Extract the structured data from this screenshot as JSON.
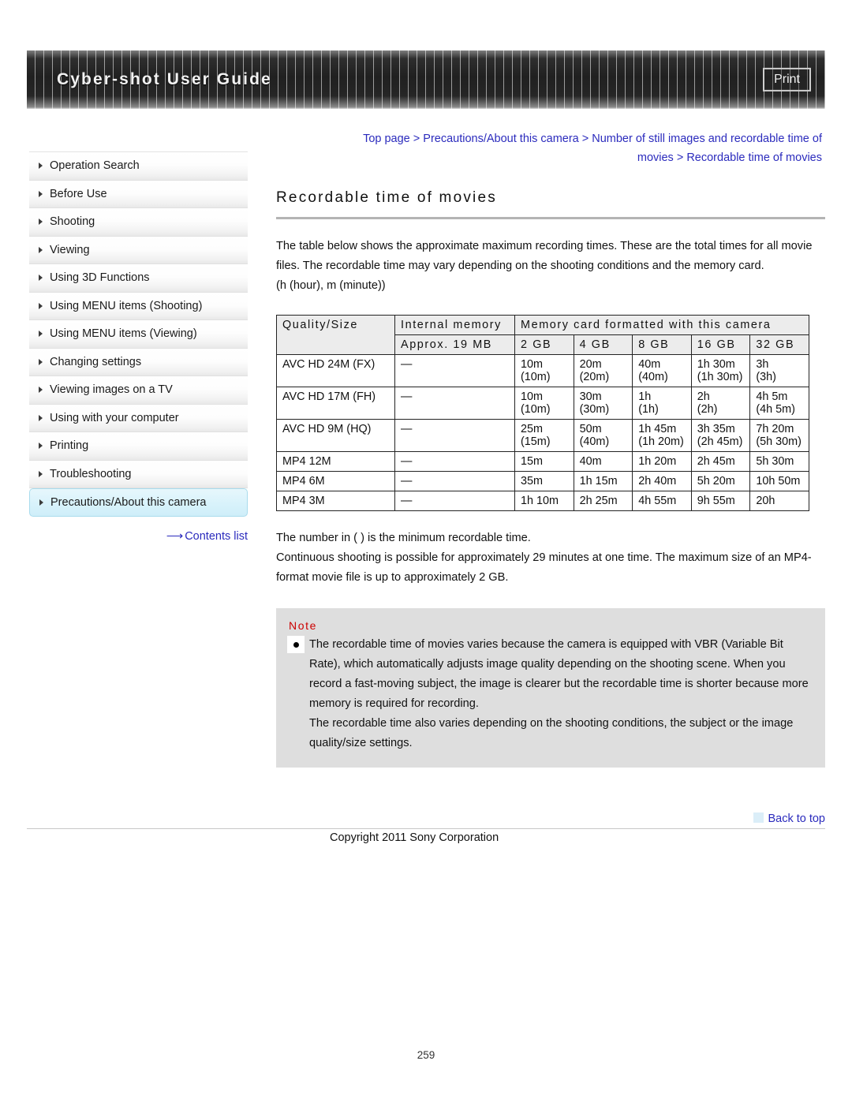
{
  "header": {
    "title": "Cyber-shot User Guide",
    "print_label": "Print"
  },
  "breadcrumb": {
    "line1": "Top page > Precautions/About this camera > Number of still images and recordable time of",
    "line2": "movies > Recordable time of movies"
  },
  "sidebar": {
    "items": [
      {
        "label": "Operation Search",
        "active": false
      },
      {
        "label": "Before Use",
        "active": false
      },
      {
        "label": "Shooting",
        "active": false
      },
      {
        "label": "Viewing",
        "active": false
      },
      {
        "label": "Using 3D Functions",
        "active": false
      },
      {
        "label": "Using MENU items (Shooting)",
        "active": false
      },
      {
        "label": "Using MENU items (Viewing)",
        "active": false
      },
      {
        "label": "Changing settings",
        "active": false
      },
      {
        "label": "Viewing images on a TV",
        "active": false
      },
      {
        "label": "Using with your computer",
        "active": false
      },
      {
        "label": "Printing",
        "active": false
      },
      {
        "label": "Troubleshooting",
        "active": false
      },
      {
        "label": "Precautions/About this camera",
        "active": true
      }
    ],
    "contents_link": "Contents list",
    "contents_arrow": "⟶"
  },
  "main": {
    "title": "Recordable time of movies",
    "intro": "The table below shows the approximate maximum recording times. These are the total times for all movie files. The recordable time may vary depending on the shooting conditions and the memory card.",
    "units_note": "(h (hour), m (minute))",
    "after_table_1": "The number in ( ) is the minimum recordable time.",
    "after_table_2": "Continuous shooting is possible for approximately 29 minutes at one time. The maximum size of an MP4-format movie file is up to approximately 2 GB."
  },
  "table": {
    "header": {
      "quality_size": "Quality/Size",
      "internal_memory": "Internal memory",
      "memory_card": "Memory card formatted with this camera",
      "capacities": [
        "Approx. 19 MB",
        "2 GB",
        "4 GB",
        "8 GB",
        "16 GB",
        "32 GB"
      ]
    },
    "rows": [
      {
        "quality": "AVC HD 24M (FX)",
        "internal": "—",
        "cells": [
          {
            "main": "10m",
            "min": "(10m)"
          },
          {
            "main": "20m",
            "min": "(20m)"
          },
          {
            "main": "40m",
            "min": "(40m)"
          },
          {
            "main": "1h 30m",
            "min": "(1h 30m)"
          },
          {
            "main": "3h",
            "min": "(3h)"
          }
        ]
      },
      {
        "quality": "AVC HD 17M (FH)",
        "internal": "—",
        "cells": [
          {
            "main": "10m",
            "min": "(10m)"
          },
          {
            "main": "30m",
            "min": "(30m)"
          },
          {
            "main": "1h",
            "min": "(1h)"
          },
          {
            "main": "2h",
            "min": "(2h)"
          },
          {
            "main": "4h 5m",
            "min": "(4h 5m)"
          }
        ]
      },
      {
        "quality": "AVC HD 9M (HQ)",
        "internal": "—",
        "cells": [
          {
            "main": "25m",
            "min": "(15m)"
          },
          {
            "main": "50m",
            "min": "(40m)"
          },
          {
            "main": "1h 45m",
            "min": "(1h 20m)"
          },
          {
            "main": "3h 35m",
            "min": "(2h 45m)"
          },
          {
            "main": "7h 20m",
            "min": "(5h 30m)"
          }
        ]
      },
      {
        "quality": "MP4 12M",
        "internal": "—",
        "cells": [
          {
            "main": "15m",
            "min": ""
          },
          {
            "main": "40m",
            "min": ""
          },
          {
            "main": "1h 20m",
            "min": ""
          },
          {
            "main": "2h 45m",
            "min": ""
          },
          {
            "main": "5h 30m",
            "min": ""
          }
        ]
      },
      {
        "quality": "MP4 6M",
        "internal": "—",
        "cells": [
          {
            "main": "35m",
            "min": ""
          },
          {
            "main": "1h 15m",
            "min": ""
          },
          {
            "main": "2h 40m",
            "min": ""
          },
          {
            "main": "5h 20m",
            "min": ""
          },
          {
            "main": "10h 50m",
            "min": ""
          }
        ]
      },
      {
        "quality": "MP4 3M",
        "internal": "—",
        "cells": [
          {
            "main": "1h 10m",
            "min": ""
          },
          {
            "main": "2h 25m",
            "min": ""
          },
          {
            "main": "4h 55m",
            "min": ""
          },
          {
            "main": "9h 55m",
            "min": ""
          },
          {
            "main": "20h",
            "min": ""
          }
        ]
      }
    ]
  },
  "note": {
    "title": "Note",
    "paragraph1": "The recordable time of movies varies because the camera is equipped with VBR (Variable Bit Rate), which automatically adjusts image quality depending on the shooting scene. When you record a fast-moving subject, the image is clearer but the recordable time is shorter because more memory is required for recording.",
    "paragraph2": "The recordable time also varies depending on the shooting conditions, the subject or the image quality/size settings."
  },
  "footer": {
    "back_to_top": "Back to top",
    "copyright": "Copyright 2011 Sony Corporation",
    "page_number": "259"
  },
  "colors": {
    "link": "#2b2bbd",
    "note_title": "#cc0000",
    "active_sidebar": "#d7f2fb",
    "table_header": "#ececec",
    "note_bg": "#dedede"
  }
}
